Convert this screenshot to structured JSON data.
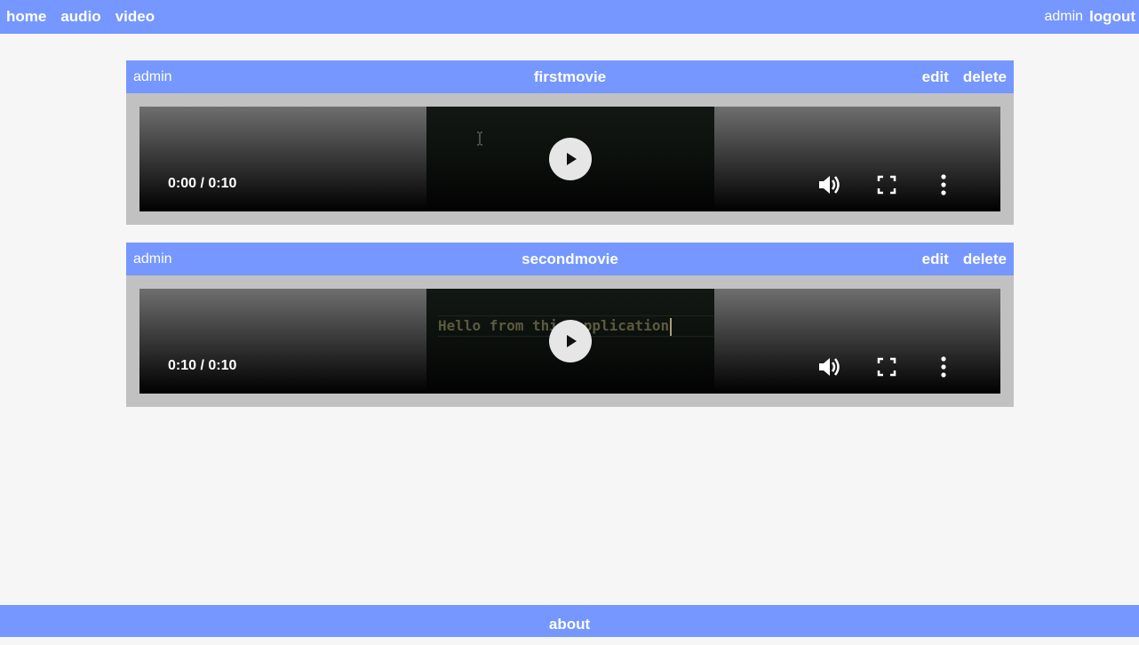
{
  "nav": {
    "links": [
      "home",
      "audio",
      "video"
    ],
    "user": "admin",
    "logout": "logout"
  },
  "videos": [
    {
      "owner": "admin",
      "title": "firstmovie",
      "edit": "edit",
      "delete": "delete",
      "time": "0:00 / 0:10",
      "caption": ""
    },
    {
      "owner": "admin",
      "title": "secondmovie",
      "edit": "edit",
      "delete": "delete",
      "time": "0:10 / 0:10",
      "caption": "Hello from this application"
    }
  ],
  "footer": {
    "about": "about"
  },
  "colors": {
    "accent": "#7597ff",
    "card_bg": "#c1c1c1",
    "page_bg": "#f6f6f6"
  },
  "icons": {
    "play": "play-icon",
    "volume": "volume-icon",
    "fullscreen": "fullscreen-icon",
    "more": "more-vert-icon"
  }
}
